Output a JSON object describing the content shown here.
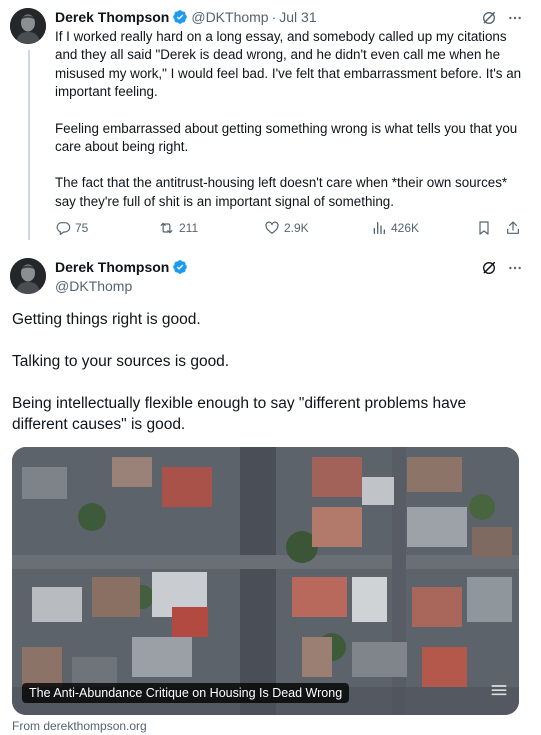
{
  "tweet1": {
    "author_name": "Derek Thompson",
    "author_handle": "@DKThomp",
    "separator": "·",
    "date": "Jul 31",
    "paragraphs": [
      "If I worked really hard on a long essay, and somebody called up my citations and they all said \"Derek is dead wrong, and he didn't even call me when he misused my work,\" I would feel bad. I've felt that embarrassment before. It's an important feeling.",
      "Feeling embarrassed about getting something wrong is what tells you that you care about being right.",
      "The fact that the antitrust-housing left doesn't care when *their own sources* say they're full of shit is an important signal of something."
    ],
    "replies": "75",
    "reposts": "211",
    "likes": "2.9K",
    "views": "426K"
  },
  "tweet2": {
    "author_name": "Derek Thompson",
    "author_handle": "@DKThomp",
    "paragraphs": [
      "Getting things right is good.",
      "Talking to your sources is good.",
      "Being intellectually flexible enough to say \"different problems have different causes\" is good."
    ],
    "card_title": "The Anti-Abundance Critique on Housing Is Dead Wrong",
    "card_source": "From derekthompson.org"
  },
  "icons": {
    "verified": "verified-badge-icon",
    "grok": "grok-icon",
    "more": "more-icon",
    "reply": "reply-icon",
    "repost": "repost-icon",
    "like": "like-icon",
    "views": "views-icon",
    "bookmark": "bookmark-icon",
    "share": "share-icon"
  },
  "colors": {
    "text": "#0f1419",
    "secondary": "#536471",
    "verified": "#1d9bf0",
    "thread_line": "#cfd9de"
  }
}
